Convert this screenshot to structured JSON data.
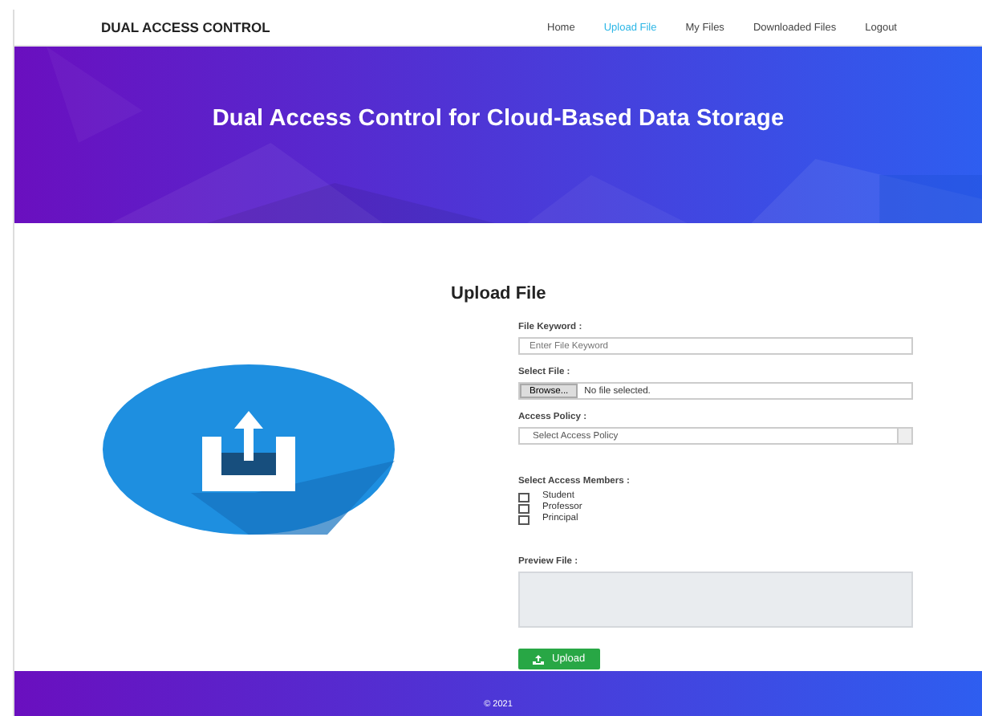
{
  "navbar": {
    "brand": "DUAL ACCESS CONTROL",
    "links": [
      {
        "label": "Home",
        "selected": false
      },
      {
        "label": "Upload File",
        "selected": true
      },
      {
        "label": "My Files",
        "selected": false
      },
      {
        "label": "Downloaded Files",
        "selected": false
      },
      {
        "label": "Logout",
        "selected": false
      }
    ]
  },
  "hero": {
    "title": "Dual Access Control for Cloud-Based Data Storage"
  },
  "form": {
    "heading": "Upload File",
    "keyword": {
      "label": "File Keyword :",
      "placeholder": "Enter File Keyword"
    },
    "file": {
      "label": "Select File :",
      "button": "Browse...",
      "status": "No file selected."
    },
    "policy": {
      "label": "Access Policy :",
      "value": "Select Access Policy"
    },
    "members": {
      "label": "Select Access Members :",
      "options": [
        {
          "label": "Student",
          "checked": false
        },
        {
          "label": "Professor",
          "checked": false
        },
        {
          "label": "Principal",
          "checked": false
        }
      ]
    },
    "preview": {
      "label": "Preview File :"
    },
    "submit": "Upload"
  },
  "footer": {
    "text": "© 2021"
  }
}
